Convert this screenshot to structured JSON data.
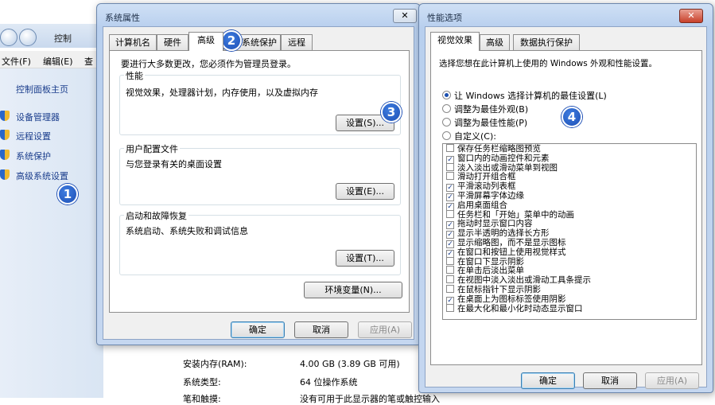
{
  "background": {
    "address_text": "控制",
    "menu": [
      "文件(F)",
      "编辑(E)",
      "查"
    ],
    "sidebar": {
      "home": "控制面板主页",
      "links": [
        "设备管理器",
        "远程设置",
        "系统保护",
        "高级系统设置"
      ]
    },
    "system_rows": [
      {
        "label": "安装内存(RAM):",
        "value": "4.00 GB (3.89 GB 可用)"
      },
      {
        "label": "系统类型:",
        "value": "64 位操作系统"
      },
      {
        "label": "笔和触摸:",
        "value": "没有可用于此显示器的笔或触控输入"
      }
    ]
  },
  "sys_dialog": {
    "title": "系统属性",
    "close": "✕",
    "tabs": [
      "计算机名",
      "硬件",
      "高级",
      "系统保护",
      "远程"
    ],
    "intro": "要进行大多数更改，您必须作为管理员登录。",
    "performance": {
      "label": "性能",
      "desc": "视觉效果，处理器计划，内存使用，以及虚拟内存",
      "button": "设置(S)..."
    },
    "profiles": {
      "label": "用户配置文件",
      "desc": "与您登录有关的桌面设置",
      "button": "设置(E)..."
    },
    "startup": {
      "label": "启动和故障恢复",
      "desc": "系统启动、系统失败和调试信息",
      "button": "设置(T)..."
    },
    "env_button": "环境变量(N)...",
    "ok": "确定",
    "cancel": "取消",
    "apply": "应用(A)"
  },
  "perf_dialog": {
    "title": "性能选项",
    "close": "✕",
    "tabs": [
      "视觉效果",
      "高级",
      "数据执行保护"
    ],
    "intro": "选择您想在此计算机上使用的 Windows 外观和性能设置。",
    "radios": [
      {
        "label": "让 Windows 选择计算机的最佳设置(L)",
        "selected": true
      },
      {
        "label": "调整为最佳外观(B)",
        "selected": false
      },
      {
        "label": "调整为最佳性能(P)",
        "selected": false
      },
      {
        "label": "自定义(C):",
        "selected": false
      }
    ],
    "effects": [
      {
        "label": "保存任务栏缩略图预览",
        "checked": false
      },
      {
        "label": "窗口内的动画控件和元素",
        "checked": true
      },
      {
        "label": "淡入淡出或滑动菜单到视图",
        "checked": false
      },
      {
        "label": "滑动打开组合框",
        "checked": false
      },
      {
        "label": "平滑滚动列表框",
        "checked": true
      },
      {
        "label": "平滑屏幕字体边缘",
        "checked": true
      },
      {
        "label": "启用桌面组合",
        "checked": true
      },
      {
        "label": "任务栏和「开始」菜单中的动画",
        "checked": false
      },
      {
        "label": "拖动时显示窗口内容",
        "checked": true
      },
      {
        "label": "显示半透明的选择长方形",
        "checked": true
      },
      {
        "label": "显示缩略图，而不是显示图标",
        "checked": true
      },
      {
        "label": "在窗口和按钮上使用视觉样式",
        "checked": true
      },
      {
        "label": "在窗口下显示阴影",
        "checked": false
      },
      {
        "label": "在单击后淡出菜单",
        "checked": false
      },
      {
        "label": "在视图中淡入淡出或滑动工具条提示",
        "checked": false
      },
      {
        "label": "在鼠标指针下显示阴影",
        "checked": false
      },
      {
        "label": "在桌面上为图标标签使用阴影",
        "checked": true
      },
      {
        "label": "在最大化和最小化时动态显示窗口",
        "checked": false
      }
    ],
    "ok": "确定",
    "cancel": "取消",
    "apply": "应用(A)"
  },
  "badges": [
    "1",
    "2",
    "3",
    "4"
  ]
}
